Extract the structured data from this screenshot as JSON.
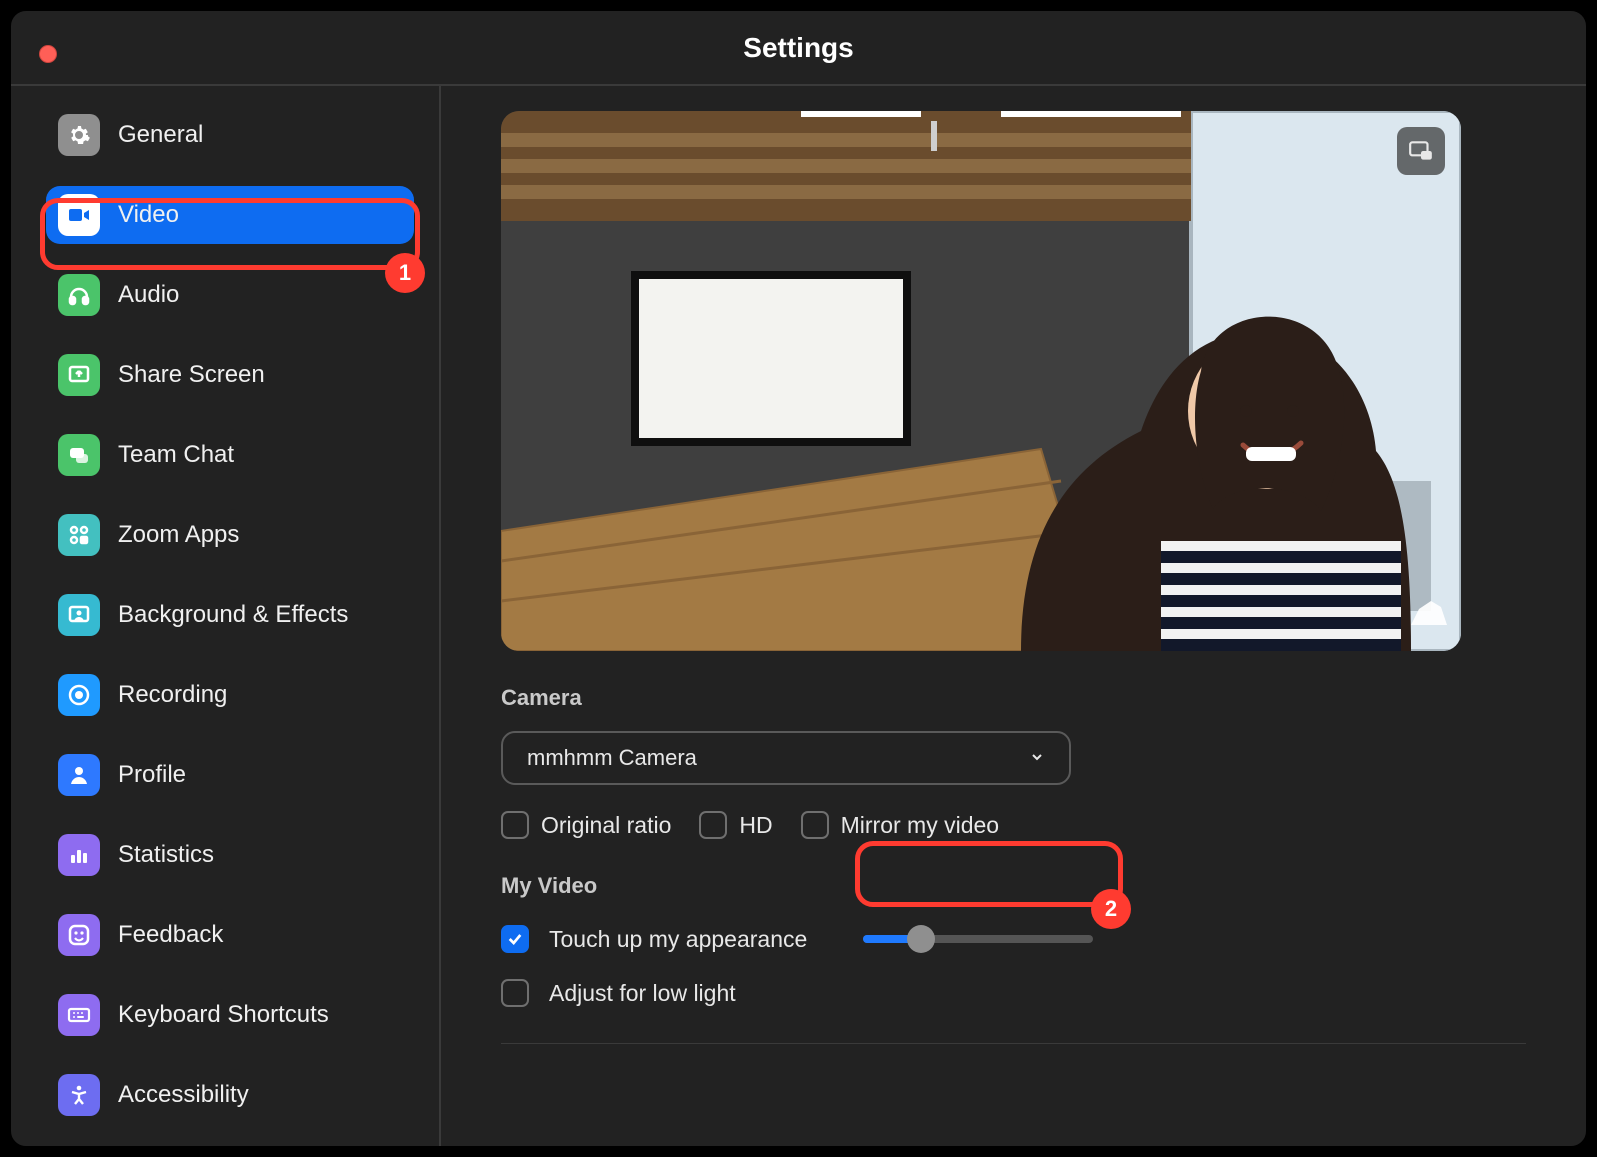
{
  "window": {
    "title": "Settings"
  },
  "sidebar": {
    "items": [
      {
        "label": "General",
        "icon": "gear",
        "bg": "#8f8f8f",
        "fg": "#ffffff"
      },
      {
        "label": "Video",
        "icon": "video",
        "bg": "#ffffff",
        "fg": "#0e6cf1",
        "active": true
      },
      {
        "label": "Audio",
        "icon": "audio",
        "bg": "#4bc46a",
        "fg": "#ffffff"
      },
      {
        "label": "Share Screen",
        "icon": "share",
        "bg": "#4bc46a",
        "fg": "#ffffff"
      },
      {
        "label": "Team Chat",
        "icon": "chat",
        "bg": "#4bc46a",
        "fg": "#ffffff"
      },
      {
        "label": "Zoom Apps",
        "icon": "apps",
        "bg": "#43c0c0",
        "fg": "#ffffff"
      },
      {
        "label": "Background & Effects",
        "icon": "bg",
        "bg": "#36bad1",
        "fg": "#ffffff"
      },
      {
        "label": "Recording",
        "icon": "rec",
        "bg": "#1f9aff",
        "fg": "#ffffff"
      },
      {
        "label": "Profile",
        "icon": "profile",
        "bg": "#2e79ff",
        "fg": "#ffffff"
      },
      {
        "label": "Statistics",
        "icon": "stats",
        "bg": "#8e6cf0",
        "fg": "#ffffff"
      },
      {
        "label": "Feedback",
        "icon": "smile",
        "bg": "#8e6cf0",
        "fg": "#ffffff"
      },
      {
        "label": "Keyboard Shortcuts",
        "icon": "keyboard",
        "bg": "#8e6cf0",
        "fg": "#ffffff"
      },
      {
        "label": "Accessibility",
        "icon": "access",
        "bg": "#6d6df1",
        "fg": "#ffffff"
      }
    ]
  },
  "video": {
    "cameraSection": "Camera",
    "selectedCamera": "mmhmm Camera",
    "options": {
      "originalRatio": {
        "label": "Original ratio",
        "checked": false
      },
      "hd": {
        "label": "HD",
        "checked": false
      },
      "mirror": {
        "label": "Mirror my video",
        "checked": false
      }
    },
    "myVideoSection": "My Video",
    "touchUp": {
      "label": "Touch up my appearance",
      "checked": true,
      "slider": 25
    },
    "lowLight": {
      "label": "Adjust for low light",
      "checked": false
    }
  },
  "callouts": {
    "one": "1",
    "two": "2"
  }
}
